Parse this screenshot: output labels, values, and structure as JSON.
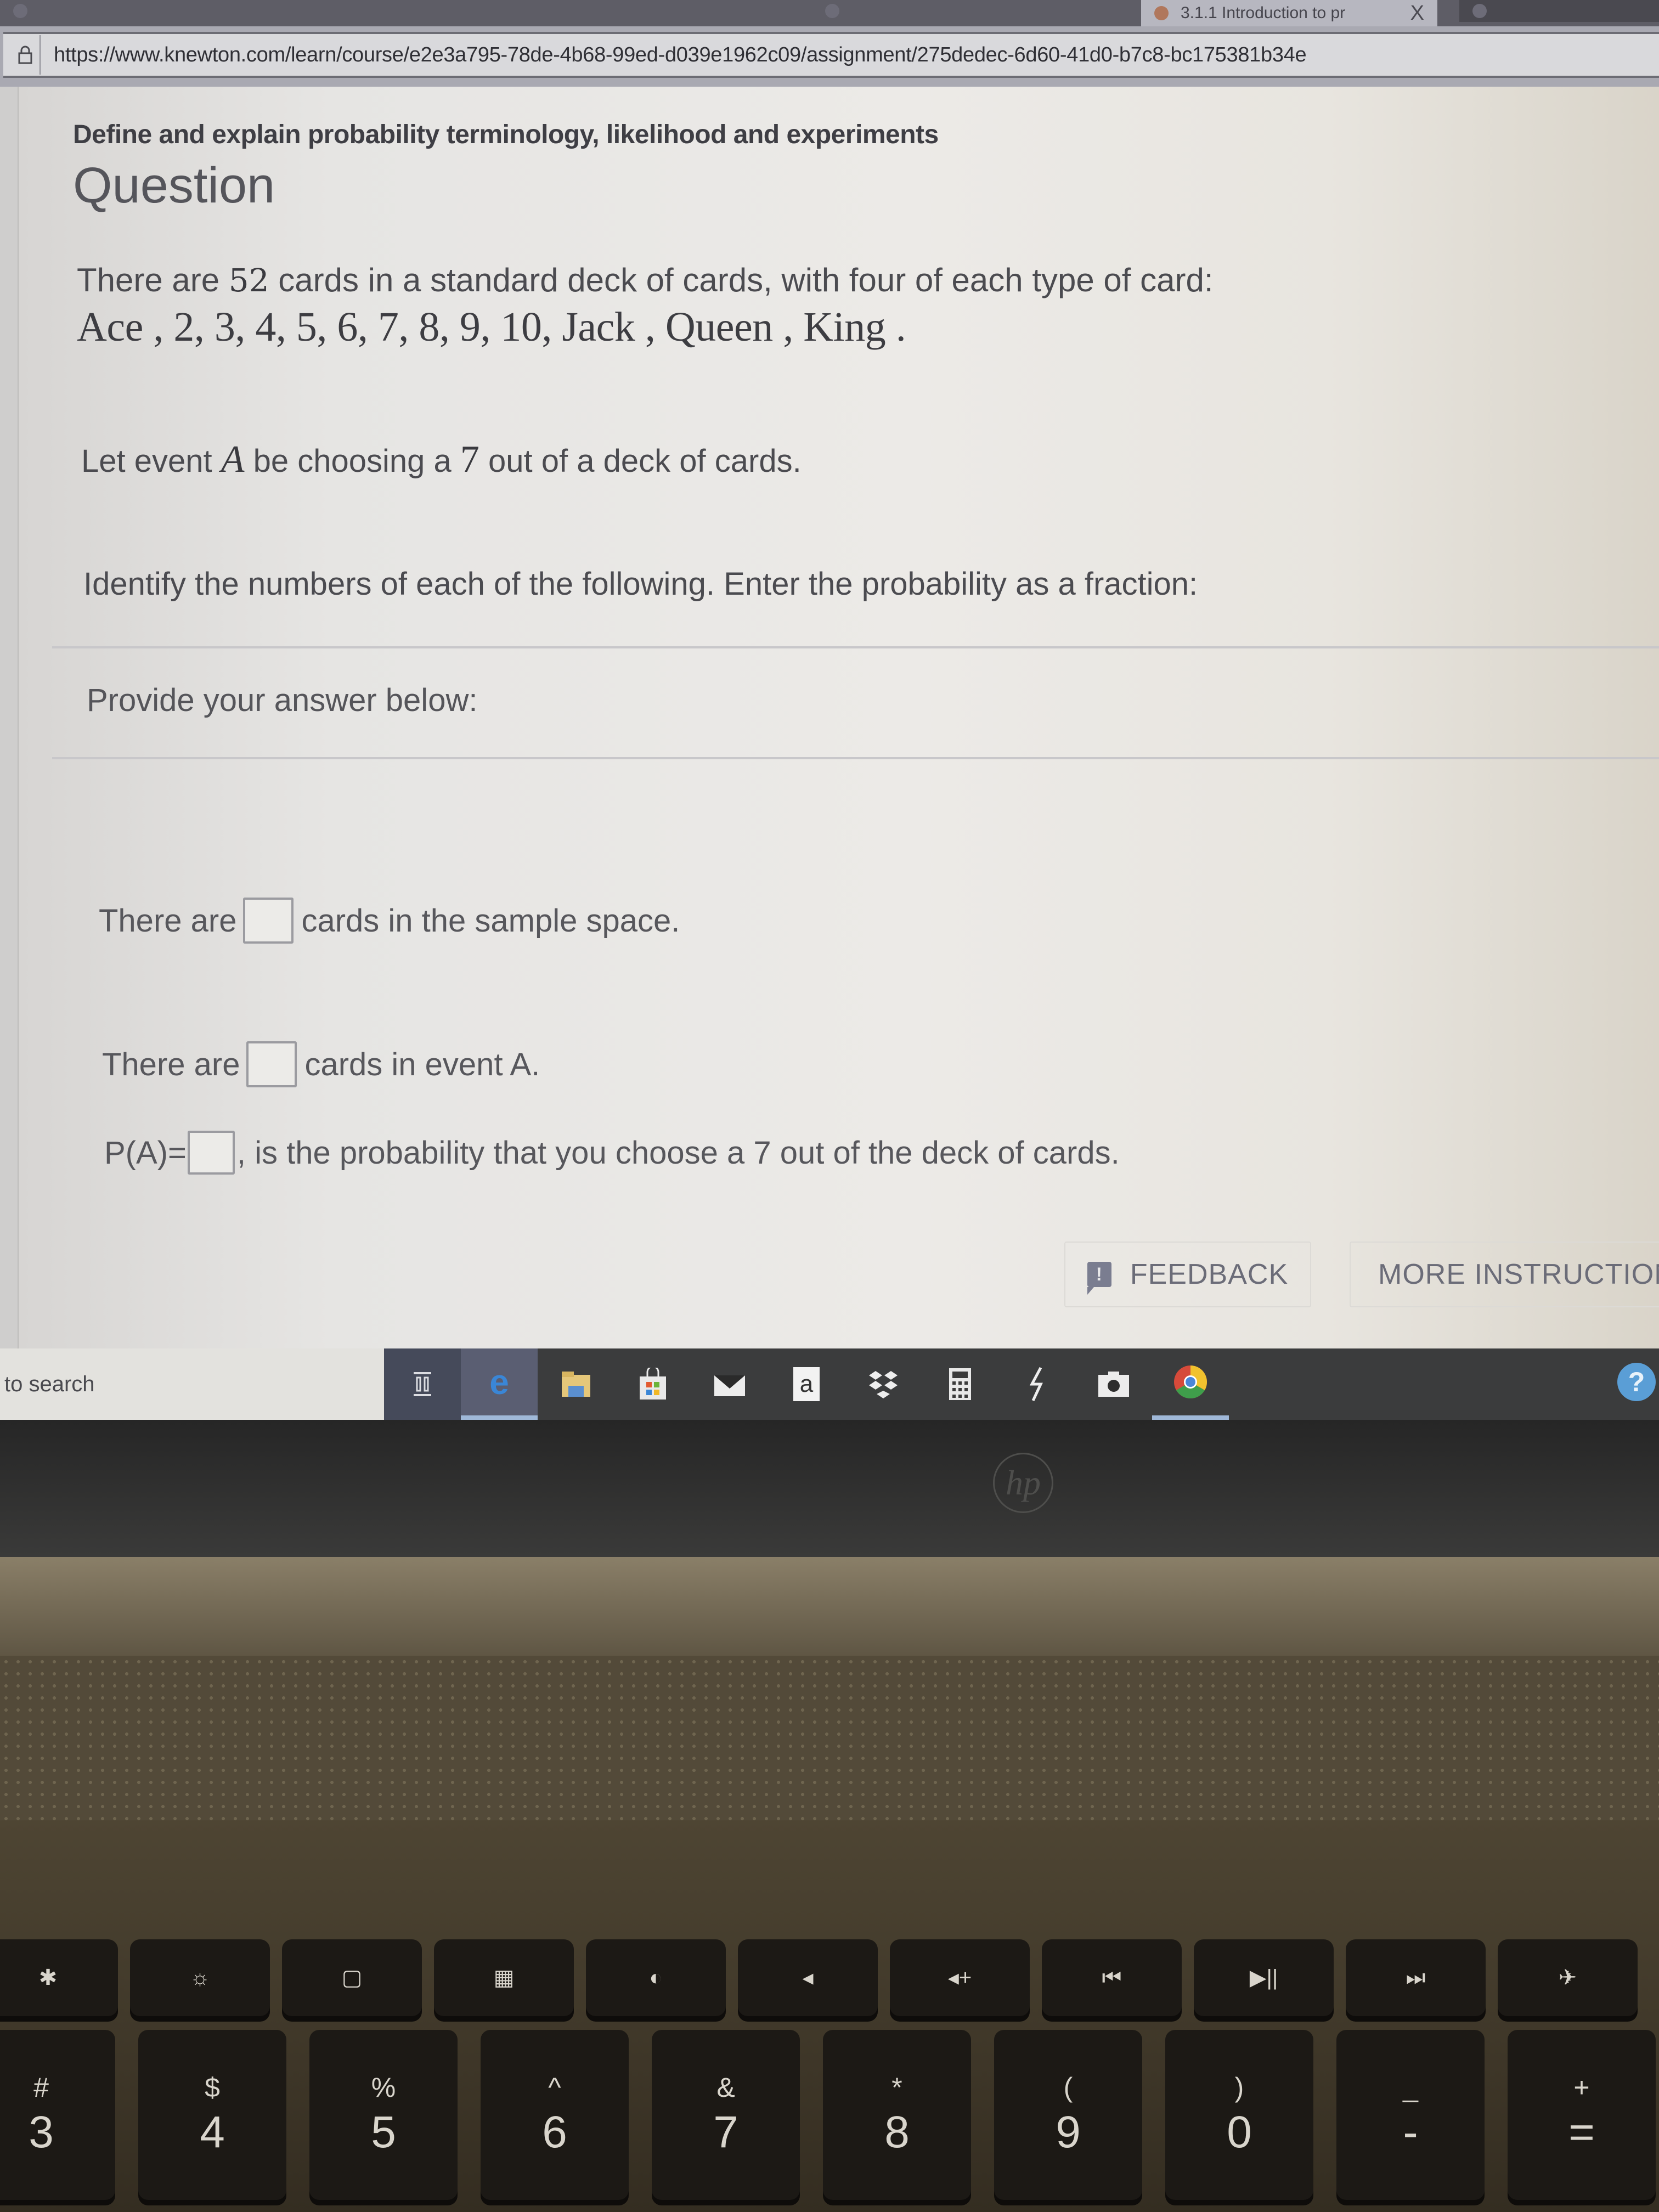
{
  "browser": {
    "tabs": [
      {
        "label": "",
        "active": false
      },
      {
        "label": "",
        "active": false
      },
      {
        "label": "3.1.1 Introduction to pr",
        "active": true,
        "close": "X"
      },
      {
        "label": "",
        "active": false
      }
    ],
    "url": "https://www.knewton.com/learn/course/e2e3a795-78de-4b68-99ed-d039e1962c09/assignment/275dedec-6d60-41d0-b7c8-bc175381b34e",
    "lock_icon": "lock-icon"
  },
  "page": {
    "topic": "Define and explain probability terminology, likelihood and experiments",
    "heading": "Question",
    "intro": {
      "before": "There are ",
      "number": "52",
      "after": " cards in a standard deck of cards, with four of each type of card:"
    },
    "card_types": "Ace , 2, 3, 4, 5, 6, 7, 8, 9, 10, Jack , Queen , King .",
    "event": {
      "before": "Let event ",
      "var": "A",
      "middle": " be choosing a ",
      "number": "7",
      "after": " out of a deck of cards."
    },
    "instruction": "Identify the numbers of each of the following. Enter the probability as a fraction:",
    "prompt": "Provide your answer below:",
    "answers": [
      {
        "prefix": "There are",
        "suffix": "cards in the sample space.",
        "value": ""
      },
      {
        "prefix": "There are",
        "suffix": "cards in event A.",
        "value": ""
      },
      {
        "prefix": "P(A)=",
        "suffix": ", is the probability that you choose a 7 out of the deck of cards.",
        "value": ""
      }
    ],
    "buttons": {
      "feedback": "FEEDBACK",
      "feedback_icon_glyph": "!",
      "more_instructions": "MORE INSTRUCTION"
    }
  },
  "taskbar": {
    "search_text": "to search",
    "icons": [
      "task-view",
      "edge",
      "file-explorer",
      "store",
      "mail",
      "amazon",
      "dropbox",
      "calculator",
      "snipping",
      "camera",
      "chrome"
    ],
    "amazon_glyph": "a",
    "help_glyph": "?"
  },
  "laptop": {
    "brand": "hp",
    "fn_keys": [
      "✱",
      "☼",
      "▢",
      "▦",
      "◐",
      "◂",
      "◂+",
      "⏮",
      "▶||",
      "⏭",
      "✈"
    ],
    "number_keys": [
      {
        "shift": "#",
        "main": "3"
      },
      {
        "shift": "$",
        "main": "4"
      },
      {
        "shift": "%",
        "main": "5"
      },
      {
        "shift": "^",
        "main": "6"
      },
      {
        "shift": "&",
        "main": "7"
      },
      {
        "shift": "*",
        "main": "8"
      },
      {
        "shift": "(",
        "main": "9"
      },
      {
        "shift": ")",
        "main": "0"
      },
      {
        "shift": "_",
        "main": "-"
      },
      {
        "shift": "+",
        "main": "="
      }
    ]
  }
}
